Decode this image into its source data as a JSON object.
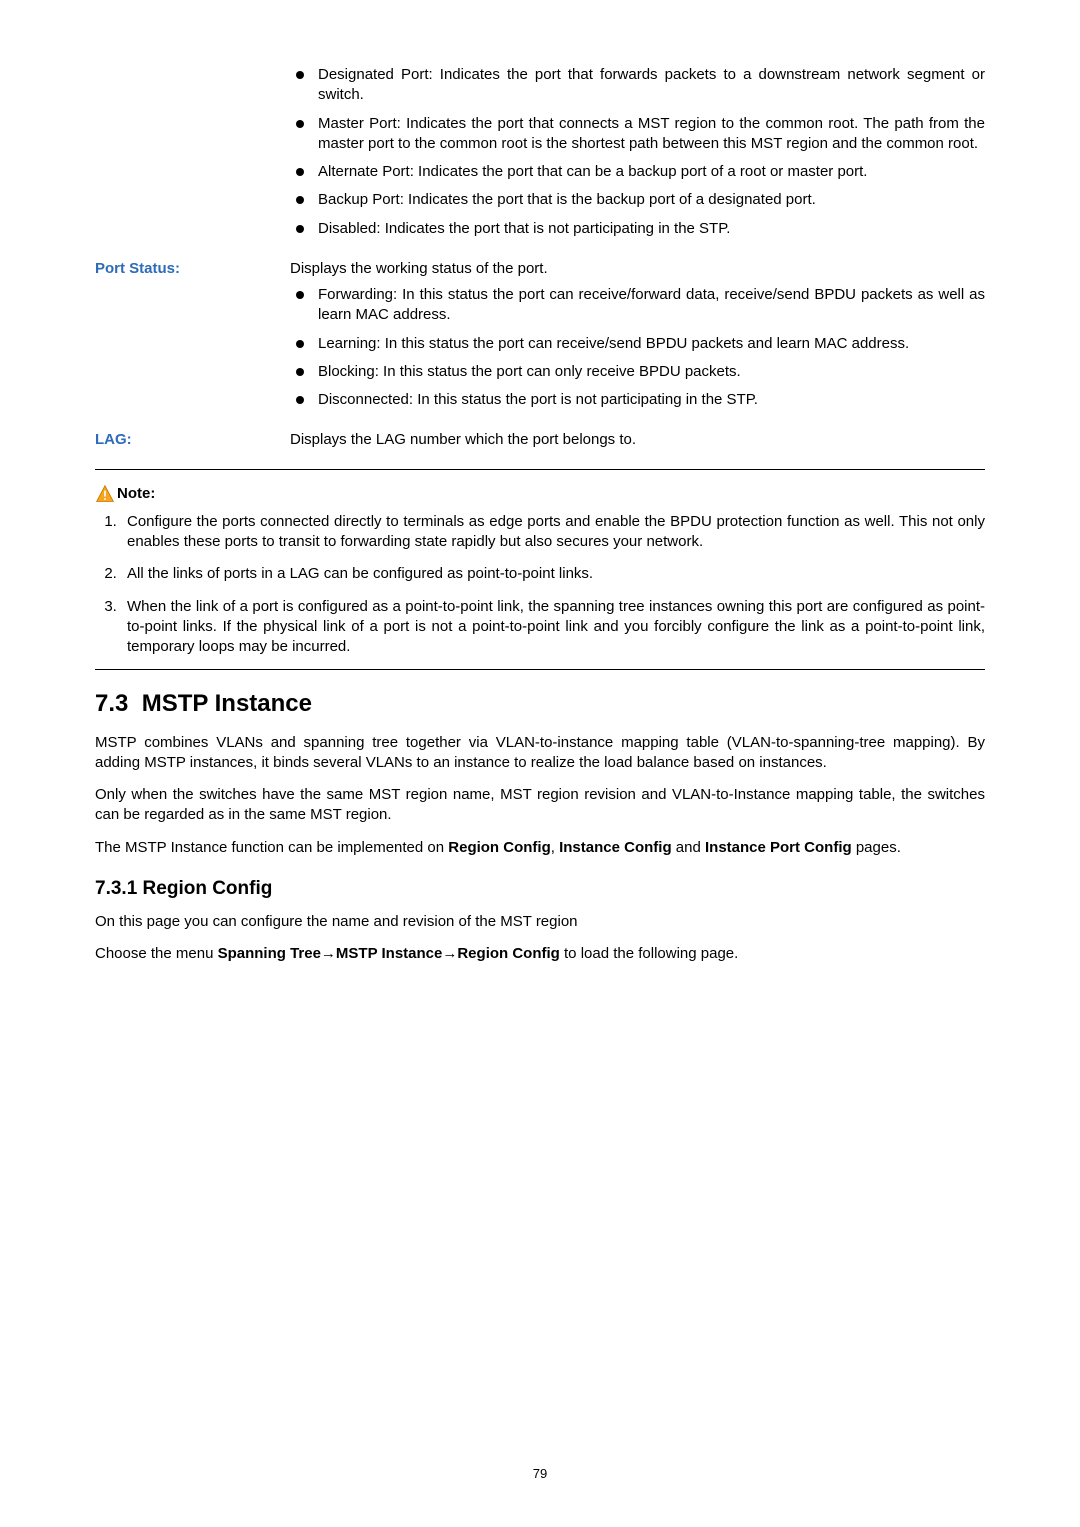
{
  "top_bullets": [
    "Designated Port: Indicates the port that forwards packets to a downstream network segment or switch.",
    "Master Port: Indicates the port that connects a MST region to the common root. The path from the master port to the common root is the shortest path between this MST region and the common root.",
    "Alternate Port: Indicates the port that can be a backup port of a root or master port.",
    "Backup Port: Indicates the port that is the backup port of a designated port.",
    "Disabled: Indicates the port that is not participating in the STP."
  ],
  "port_status": {
    "label": "Port Status:",
    "desc": "Displays the working status of the port.",
    "bullets": [
      "Forwarding: In this status the port can receive/forward data, receive/send BPDU packets as well as learn MAC address.",
      "Learning: In this status the port can receive/send BPDU packets and learn MAC address.",
      "Blocking: In this status the port can only receive BPDU packets.",
      "Disconnected: In this status the port is not participating in the STP."
    ]
  },
  "lag": {
    "label": "LAG:",
    "desc": "Displays the LAG number which the port belongs to."
  },
  "note": {
    "label": "Note:",
    "items": [
      "Configure the ports connected directly to terminals as edge ports and enable the BPDU protection function as well. This not only enables these ports to transit to forwarding state rapidly but also secures your network.",
      "All the links of ports in a LAG can be configured as point-to-point links.",
      "When the link of a port is configured as a point-to-point link, the spanning tree instances owning this port are configured as point-to-point links. If the physical link of a port is not a point-to-point link and you forcibly configure the link as a point-to-point link, temporary loops may be incurred."
    ]
  },
  "section": {
    "num": "7.3",
    "title": "MSTP Instance",
    "p1": "MSTP combines VLANs and spanning tree together via VLAN-to-instance mapping table (VLAN-to-spanning-tree mapping). By adding MSTP instances, it binds several VLANs to an instance to realize the load balance based on instances.",
    "p2": "Only when the switches have the same MST region name, MST region revision and VLAN-to-Instance mapping table, the switches can be regarded as in the same MST region.",
    "p3_pre": "The MSTP Instance function can be implemented on ",
    "p3_b1": "Region Config",
    "p3_mid1": ", ",
    "p3_b2": "Instance Config",
    "p3_mid2": " and ",
    "p3_b3": "Instance Port Config",
    "p3_post": " pages."
  },
  "subsection": {
    "num": "7.3.1",
    "title": "Region Config",
    "p1": "On this page you can configure the name and revision of the MST region",
    "p2_pre": "Choose the menu ",
    "p2_path": "Spanning Tree→MSTP Instance→Region Config",
    "p2_post": " to load the following page."
  },
  "page_number": "79"
}
